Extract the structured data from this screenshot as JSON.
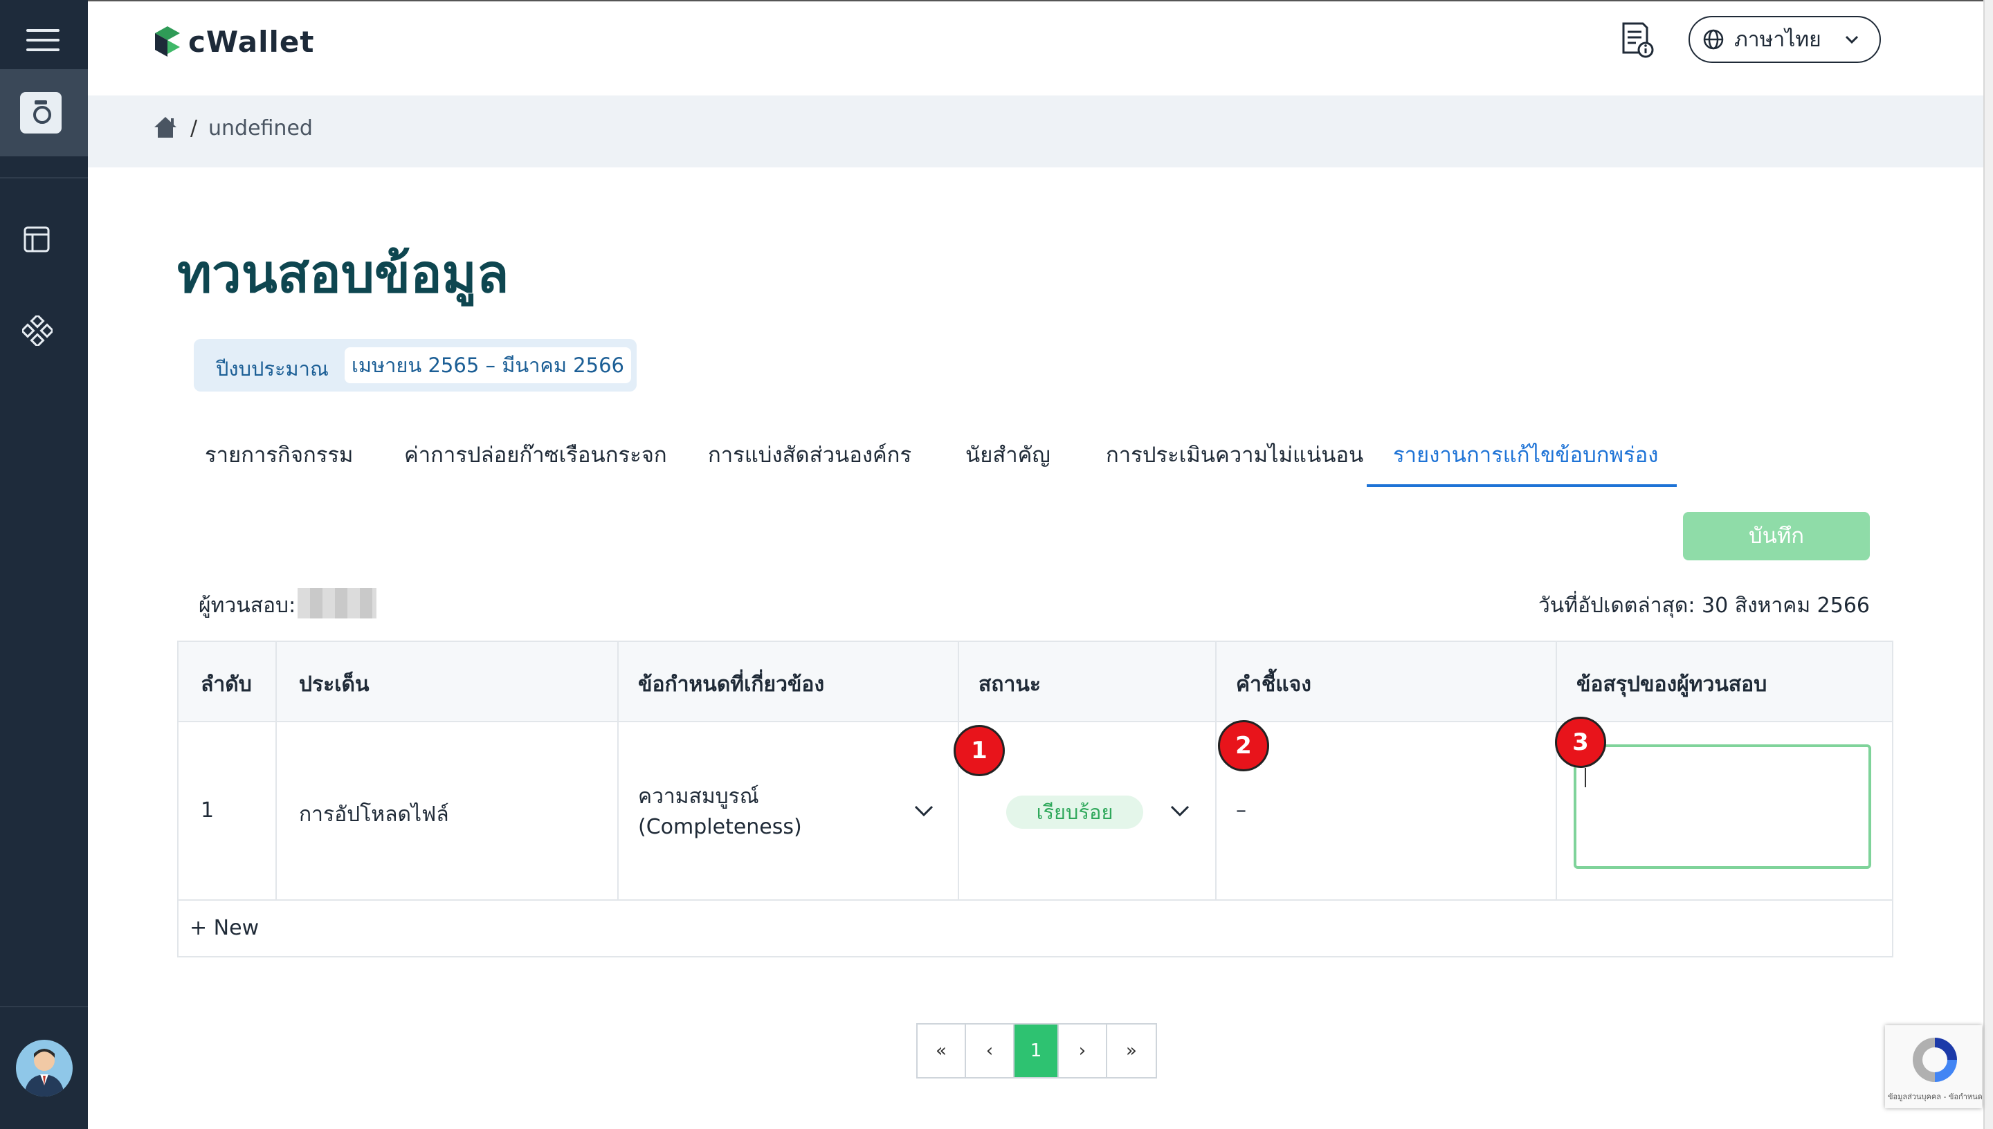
{
  "app": {
    "brand": "cWallet"
  },
  "header": {
    "language_label": "ภาษาไทย"
  },
  "breadcrumb": {
    "separator": "/",
    "current": "undefined"
  },
  "page": {
    "title": "ทวนสอบข้อมูล",
    "budget_label": "ปีงบประมาณ",
    "budget_value": "เมษายน 2565 – มีนาคม 2566"
  },
  "tabs": [
    {
      "label": "รายการกิจกรรม",
      "active": false
    },
    {
      "label": "ค่าการปล่อยก๊าซเรือนกระจก",
      "active": false
    },
    {
      "label": "การแบ่งสัดส่วนองค์กร",
      "active": false
    },
    {
      "label": "นัยสำคัญ",
      "active": false
    },
    {
      "label": "การประเมินความไม่แน่นอน",
      "active": false
    },
    {
      "label": "รายงานการแก้ไขข้อบกพร่อง",
      "active": true
    }
  ],
  "toolbar": {
    "save_label": "บันทึก"
  },
  "meta": {
    "reviewer_label": "ผู้ทวนสอบ:",
    "updated_label": "วันที่อัปเดตล่าสุด: 30 สิงหาคม 2566"
  },
  "table": {
    "headers": [
      "ลำดับ",
      "ประเด็น",
      "ข้อกำหนดที่เกี่ยวข้อง",
      "สถานะ",
      "คำชี้แจง",
      "ข้อสรุปของผู้ทวนสอบ"
    ],
    "rows": [
      {
        "index": "1",
        "issue": "การอัปโหลดไฟล์",
        "requirement_line1": "ความสมบูรณ์",
        "requirement_line2": "(Completeness)",
        "status": "เรียบร้อย",
        "explanation": "–",
        "conclusion": ""
      }
    ],
    "new_label": "+ New"
  },
  "markers": [
    "1",
    "2",
    "3"
  ],
  "pagination": {
    "first": "«",
    "prev": "‹",
    "current": "1",
    "next": "›",
    "last": "»"
  },
  "recaptcha": {
    "text": "ข้อมูลส่วนบุคคล - ข้อกำหนด"
  },
  "colors": {
    "sidebar": "#1e2b3b",
    "title": "#0e4650",
    "accent": "#1e73d6",
    "save_button": "#8fdca8",
    "status_green": "#2fa85b",
    "marker_red": "#e8141b"
  }
}
